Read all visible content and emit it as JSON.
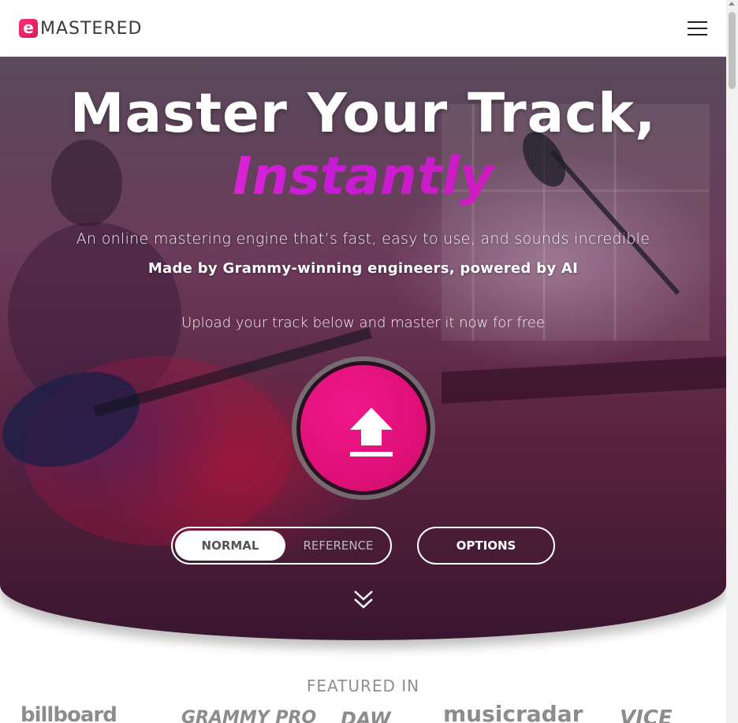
{
  "header": {
    "logo_mark": "e",
    "logo_text": "MASTERED"
  },
  "hero": {
    "title": "Master Your Track,",
    "highlight": "Instantly",
    "subtitle": "An online mastering engine that’s fast, easy to use, and sounds incredible",
    "tagline": "Made by Grammy-winning engineers, powered by AI",
    "upload_prompt": "Upload your track below and master it now for free",
    "mode_toggle": {
      "normal_label": "NORMAL",
      "reference_label": "REFERENCE",
      "selected": "NORMAL"
    },
    "options_label": "OPTIONS"
  },
  "featured": {
    "title": "FEATURED IN",
    "logos": [
      "billboard",
      "GRAMMY PRO",
      "DAW",
      "musicradar",
      "VICE"
    ]
  },
  "colors": {
    "brand": "#e8147e",
    "highlight_start": "#ff3bd0",
    "highlight_end": "#d21ea0"
  }
}
